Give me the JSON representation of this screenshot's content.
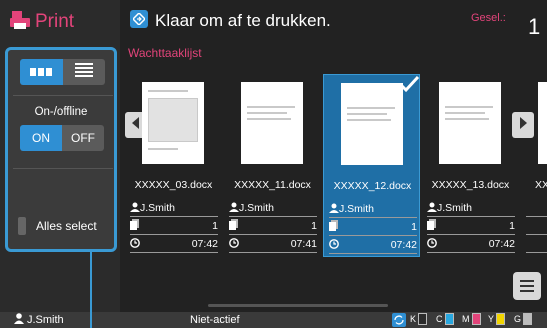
{
  "app": {
    "title": "Print"
  },
  "sidebar": {
    "online_label": "On-/offline",
    "on_label": "ON",
    "off_label": "OFF",
    "select_all_label": "Alles select"
  },
  "header": {
    "status_message": "Klaar om af te drukken.",
    "selected_label": "Gesel.:",
    "selected_count": "1"
  },
  "list": {
    "title": "Wachttaaklijst",
    "jobs": [
      {
        "file": "XXXXX_03.docx",
        "user": "J.Smith",
        "copies": "1",
        "time": "07:42"
      },
      {
        "file": "XXXXX_11.docx",
        "user": "J.Smith",
        "copies": "1",
        "time": "07:41"
      },
      {
        "file": "XXXXX_12.docx",
        "user": "J.Smith",
        "copies": "1",
        "time": "07:42"
      },
      {
        "file": "XXXXX_13.docx",
        "user": "J.Smith",
        "copies": "1",
        "time": "07:42"
      },
      {
        "file": "XX",
        "user": "",
        "copies": "",
        "time": ""
      }
    ]
  },
  "statusbar": {
    "user": "J.Smith",
    "machine_status": "Niet-actief",
    "inks": [
      {
        "label": "K",
        "color": "#ffffff"
      },
      {
        "label": "C",
        "color": "#29a8e0"
      },
      {
        "label": "M",
        "color": "#e2447a"
      },
      {
        "label": "Y",
        "color": "#f2d500"
      },
      {
        "label": "G",
        "color": "#bdbdbd"
      }
    ]
  },
  "colors": {
    "accent": "#2f8fd3",
    "brand": "#e2447a",
    "background": "#2b2b2b"
  }
}
